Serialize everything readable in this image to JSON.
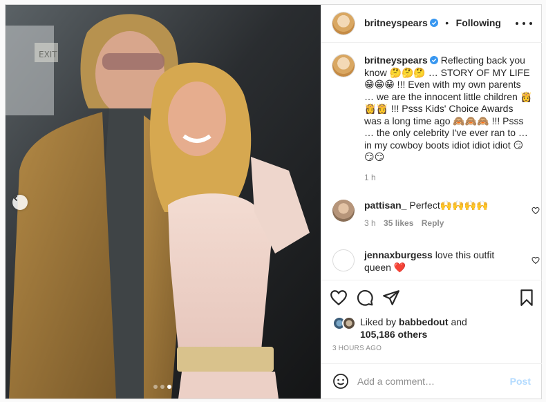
{
  "post": {
    "author": "britneyspears",
    "separator": "•",
    "follow_label": "Following",
    "more_icon": "more-horizontal-icon",
    "carousel": {
      "slides": 3,
      "active_index": 2
    }
  },
  "caption": {
    "username": "britneyspears",
    "text": "Reflecting back you know 🤔🤔🤔 … STORY OF MY LIFE 😁😁😁 !!! Even with my own parents … we are the innocent little children 👸👸👸 !!! Psss Kids' Choice Awards was a long time ago 🙈🙈🙈 !!! Psss … the only celebrity I've ever ran to … in my cowboy boots idiot idiot idiot 😏😏😏",
    "time": "1 h"
  },
  "comments": [
    {
      "username": "pattisan_",
      "text": "Perfect🙌🙌🙌🙌",
      "time": "3 h",
      "likes": "35 likes",
      "reply": "Reply"
    },
    {
      "username": "jennaxburgess",
      "text": "love this outfit queen ❤️"
    }
  ],
  "likes": {
    "prefix": "Liked by",
    "user": "babbedout",
    "and": "and",
    "others": "105,186 others"
  },
  "timestamp": "3 HOURS AGO",
  "add_comment": {
    "placeholder": "Add a comment…",
    "post_label": "Post"
  },
  "colors": {
    "verified": "#3897f0",
    "post_disabled": "#b3dbff",
    "heart_red": "#ed4956"
  }
}
